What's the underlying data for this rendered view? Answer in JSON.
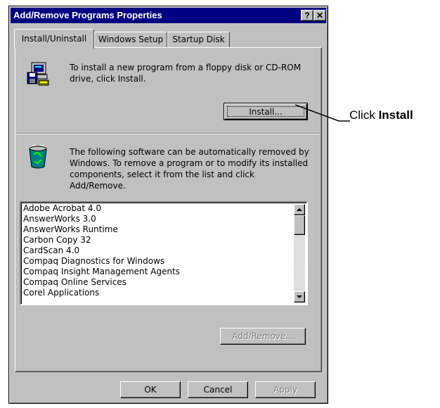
{
  "window": {
    "title": "Add/Remove Programs Properties",
    "help_button": "?",
    "close_button": "✕"
  },
  "tabs": [
    {
      "label": "Install/Uninstall",
      "selected": true
    },
    {
      "label": "Windows Setup",
      "selected": false
    },
    {
      "label": "Startup Disk",
      "selected": false
    }
  ],
  "install_section": {
    "icon": "floppy-computer-icon",
    "line1": "To install a new program from a floppy disk or CD-ROM",
    "line2": "drive, click Install.",
    "install_button": "Install..."
  },
  "remove_section": {
    "icon": "recycle-bin-icon",
    "line1": "The following software can be automatically removed by",
    "line2": "Windows. To remove a program or to modify its installed",
    "line3": "components, select it from the list and click",
    "line4": "Add/Remove.",
    "programs": [
      "Adobe Acrobat 4.0",
      "AnswerWorks 3.0",
      "AnswerWorks Runtime",
      "Carbon Copy 32",
      "CardScan 4.0",
      "Compaq Diagnostics for Windows",
      "Compaq Insight Management Agents",
      "Compaq Online Services",
      "Corel Applications"
    ],
    "add_remove_button": "Add/Remove..."
  },
  "footer": {
    "ok_label": "OK",
    "cancel_label": "Cancel",
    "apply_label": "Apply"
  },
  "callout": {
    "prefix": "Click ",
    "emphasis": "Install"
  }
}
